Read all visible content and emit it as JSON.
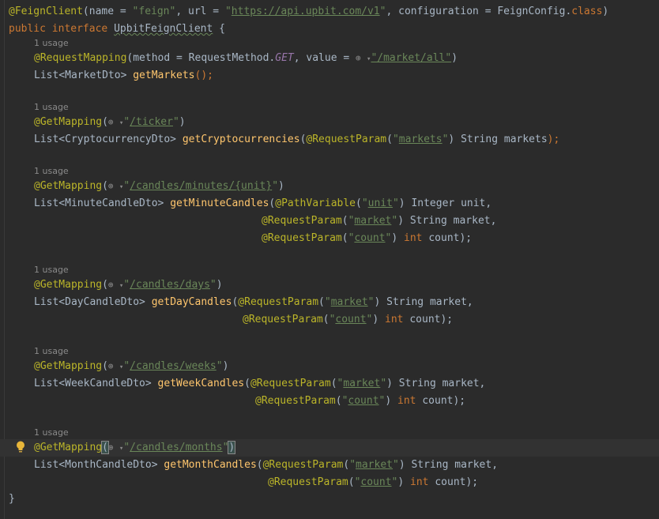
{
  "code": {
    "line1": {
      "annotation": "@FeignClient",
      "open": "(",
      "name_key": "name = ",
      "name_val": "\"feign\"",
      "sep1": ", ",
      "url_key": "url = ",
      "url_q1": "\"",
      "url_val": "https://api.upbit.com/v1",
      "url_q2": "\"",
      "sep2": ", ",
      "conf_key": "configuration = ",
      "conf_cls": "FeignConfig.",
      "conf_kw": "class",
      "close": ")"
    },
    "line2": {
      "kw1": "public ",
      "kw2": "interface ",
      "name": "UpbitFeignClient",
      "rest": " {"
    },
    "usage_label": "1 usage",
    "m1": {
      "annotation": "@RequestMapping",
      "open": "(",
      "method_key": "method = RequestMethod.",
      "method_const": "GET",
      "value_key": ", value = ",
      "path": "\"/market/all\"",
      "close": ")",
      "ret": "List<MarketDto> ",
      "fn": "getMarkets",
      "sig": "();"
    },
    "m2": {
      "annotation": "@GetMapping",
      "path": "/ticker",
      "ret": "List<CryptocurrencyDto> ",
      "fn": "getCryptocurrencies",
      "p1_ann": "@RequestParam",
      "p1_name": "markets",
      "p1_type": " String markets",
      "end": ");"
    },
    "m3": {
      "annotation": "@GetMapping",
      "path": "/candles/minutes/{unit}",
      "ret": "List<MinuteCandleDto> ",
      "fn": "getMinuteCandles",
      "p1_ann": "@PathVariable",
      "p1_name": "unit",
      "p1_type": " Integer unit,",
      "p2_ann": "@RequestParam",
      "p2_name": "market",
      "p2_type": " String market,",
      "p3_ann": "@RequestParam",
      "p3_name": "count",
      "p3_kw": " int",
      "p3_rest": " count);"
    },
    "m4": {
      "annotation": "@GetMapping",
      "path": "/candles/days",
      "ret": "List<DayCandleDto> ",
      "fn": "getDayCandles",
      "p1_ann": "@RequestParam",
      "p1_name": "market",
      "p1_type": " String market,",
      "p2_ann": "@RequestParam",
      "p2_name": "count",
      "p2_kw": " int",
      "p2_rest": " count);"
    },
    "m5": {
      "annotation": "@GetMapping",
      "path": "/candles/weeks",
      "ret": "List<WeekCandleDto> ",
      "fn": "getWeekCandles",
      "p1_ann": "@RequestParam",
      "p1_name": "market",
      "p1_type": " String market,",
      "p2_ann": "@RequestParam",
      "p2_name": "count",
      "p2_kw": " int",
      "p2_rest": " count);"
    },
    "m6": {
      "annotation": "@GetMapping",
      "path": "/candles/months",
      "ret": "List<MonthCandleDto> ",
      "fn": "getMonthCandles",
      "p1_ann": "@RequestParam",
      "p1_name": "market",
      "p1_type": " String market,",
      "p2_ann": "@RequestParam",
      "p2_name": "count",
      "p2_kw": " int",
      "p2_rest": " count);"
    },
    "closing_brace": "}"
  },
  "icons": {
    "globe": "globe-icon",
    "chevron": "chevron-down-icon",
    "bulb": "lightbulb-icon"
  },
  "colors": {
    "background": "#2b2b2b",
    "keyword": "#cc7832",
    "annotation": "#bbb529",
    "string": "#6a8759",
    "function": "#ffc66d",
    "constant": "#9876aa",
    "text": "#a9b7c6"
  }
}
